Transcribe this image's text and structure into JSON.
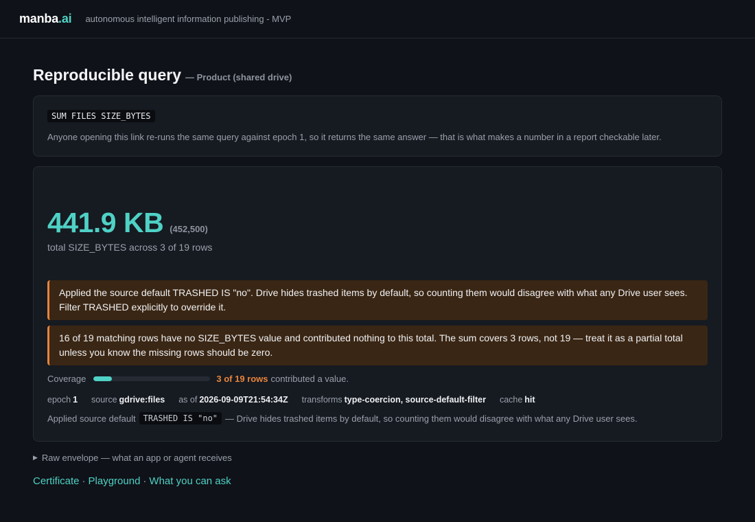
{
  "header": {
    "brand_main": "manba",
    "brand_suffix": ".ai",
    "tagline": "autonomous intelligent information publishing - MVP"
  },
  "page": {
    "title": "Reproducible query",
    "subtitle": "— Product (shared drive)"
  },
  "query": {
    "code": "SUM FILES SIZE_BYTES",
    "description": "Anyone opening this link re-runs the same query against epoch 1, so it returns the same answer — that is what makes a number in a report checkable later."
  },
  "result": {
    "value": "441.9 KB",
    "raw": "(452,500)",
    "description": "total SIZE_BYTES across 3 of 19 rows"
  },
  "warnings": [
    "Applied the source default TRASHED IS \"no\". Drive hides trashed items by default, so counting them would disagree with what any Drive user sees. Filter TRASHED explicitly to override it.",
    "16 of 19 matching rows have no SIZE_BYTES value and contributed nothing to this total. The sum covers 3 rows, not 19 — treat it as a partial total unless you know the missing rows should be zero."
  ],
  "coverage": {
    "label": "Coverage",
    "count_text": "3 of 19 rows",
    "rest_text": "contributed a value.",
    "fraction": 0.158
  },
  "meta": {
    "epoch_label": "epoch",
    "epoch_value": "1",
    "source_label": "source",
    "source_value": "gdrive:files",
    "asof_label": "as of",
    "asof_value": "2026-09-09T21:54:34Z",
    "transforms_label": "transforms",
    "transforms_value": "type-coercion, source-default-filter",
    "cache_label": "cache",
    "cache_value": "hit"
  },
  "applied": {
    "prefix": "Applied source default",
    "code": "TRASHED IS \"no\"",
    "suffix": "— Drive hides trashed items by default, so counting them would disagree with what any Drive user sees."
  },
  "envelope": {
    "label": "Raw envelope — what an app or agent receives"
  },
  "links": {
    "certificate": "Certificate",
    "playground": "Playground",
    "ask": "What you can ask",
    "separator": "·"
  },
  "colors": {
    "accent": "#4fd1c5",
    "warning": "#e8843c",
    "background": "#0f1218",
    "card": "#161a21"
  }
}
